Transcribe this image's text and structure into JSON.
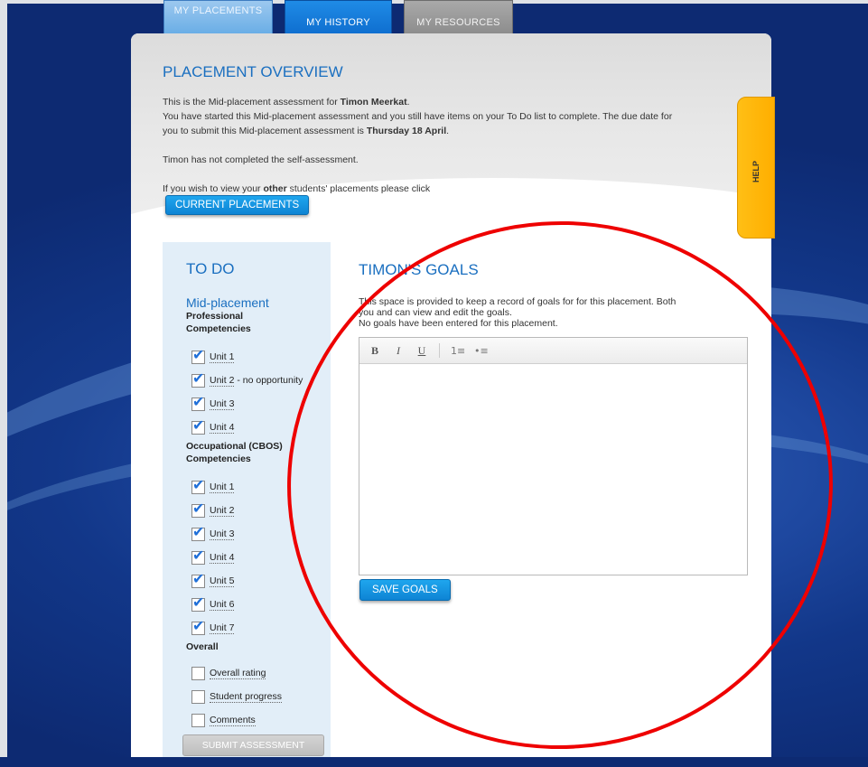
{
  "tabs": [
    {
      "label": "My Placements"
    },
    {
      "label": "My History"
    },
    {
      "label": "My Resources"
    }
  ],
  "overview": {
    "title": "PLACEMENT OVERVIEW",
    "line1_prefix": "This is the Mid-placement assessment for ",
    "student_name": "Timon Meerkat",
    "line1_suffix": ".",
    "line2": "You have started this Mid-placement assessment and you still have items on your To Do list to complete. The due date for",
    "line3_prefix": "you to submit this Mid-placement assessment is ",
    "due_date": "Thursday 18 April",
    "line3_suffix": ".",
    "self_assessment": "Timon has not completed the self-assessment.",
    "other_prefix": "If you wish to view your ",
    "other_bold": "other",
    "other_suffix": " students' placements please click",
    "current_button": "CURRENT PLACEMENTS"
  },
  "help": {
    "label": "HELP"
  },
  "todo": {
    "title": "TO DO",
    "stage": "Mid-placement",
    "sections": [
      {
        "title": "Professional Competencies",
        "items": [
          {
            "label": "Unit 1",
            "suffix": "",
            "checked": true
          },
          {
            "label": "Unit 2",
            "suffix": " - no opportunity",
            "checked": true
          },
          {
            "label": "Unit 3",
            "suffix": "",
            "checked": true
          },
          {
            "label": "Unit 4",
            "suffix": "",
            "checked": true
          }
        ]
      },
      {
        "title": "Occupational (CBOS) Competencies",
        "items": [
          {
            "label": "Unit 1",
            "checked": true
          },
          {
            "label": "Unit 2",
            "checked": true
          },
          {
            "label": "Unit 3",
            "checked": true
          },
          {
            "label": "Unit 4",
            "checked": true
          },
          {
            "label": "Unit 5",
            "checked": true
          },
          {
            "label": "Unit 6",
            "checked": true
          },
          {
            "label": "Unit 7",
            "checked": true
          }
        ]
      },
      {
        "title": "Overall",
        "items": [
          {
            "label": "Overall rating",
            "checked": false
          },
          {
            "label": "Student progress",
            "checked": false
          },
          {
            "label": "Comments",
            "checked": false
          }
        ]
      }
    ],
    "submit_button": "SUBMIT ASSESSMENT"
  },
  "goals": {
    "title": "TIMON'S GOALS",
    "desc1": "This space is provided to keep a record of goals for for this placement. Both",
    "desc2": "you and can view and edit the goals.",
    "desc3": "No goals have been entered for this placement.",
    "toolbar": {
      "bold": "B",
      "italic": "I",
      "underline": "U",
      "ordered": "1≡",
      "unordered": "•≡"
    },
    "editor_value": "",
    "save_button": "SAVE GOALS"
  },
  "colors": {
    "accent_blue": "#1a6fc0",
    "help_yellow": "#ffb400",
    "annotation_red": "#ee0000"
  }
}
